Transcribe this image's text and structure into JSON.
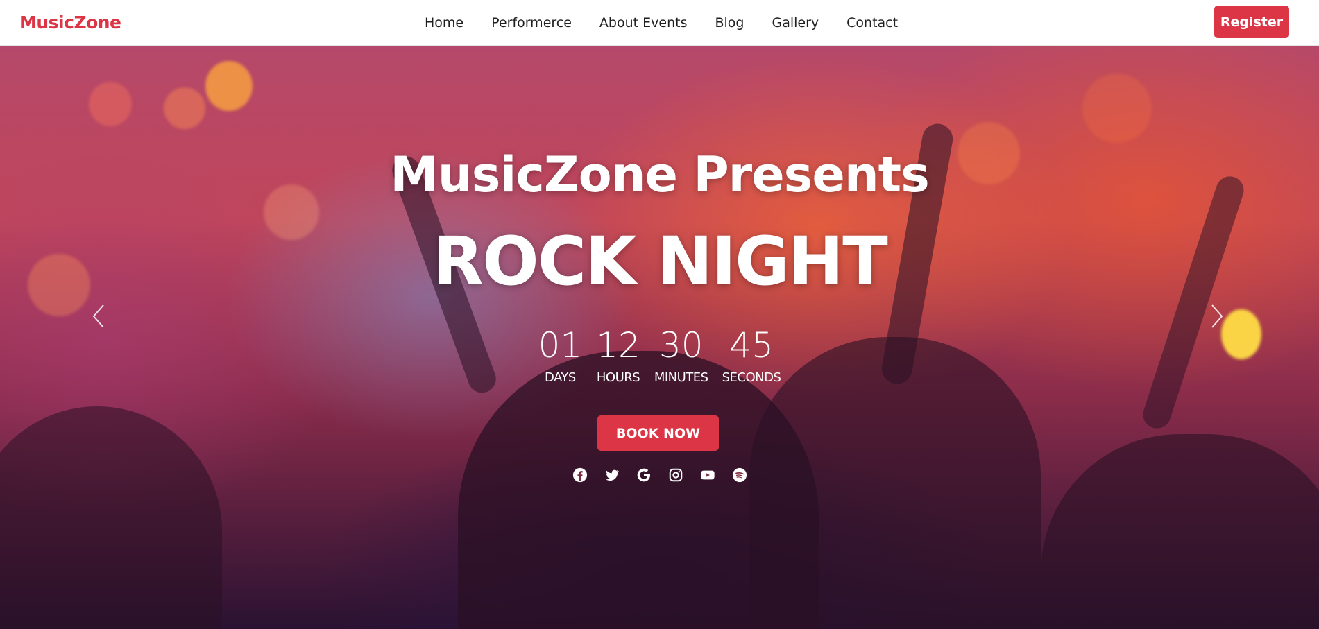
{
  "nav": {
    "brand": "MusicZone",
    "links": [
      "Home",
      "Performerce",
      "About Events",
      "Blog",
      "Gallery",
      "Contact"
    ],
    "register_label": "Register"
  },
  "hero": {
    "presents": "MusicZone Presents",
    "event_name": "ROCK NIGHT",
    "countdown": [
      {
        "value": "01",
        "label": "DAYS"
      },
      {
        "value": "12",
        "label": "HOURS"
      },
      {
        "value": "30",
        "label": "MINUTES"
      },
      {
        "value": "45",
        "label": "SECONDS"
      }
    ],
    "book_label": "BOOK NOW",
    "socials": [
      "facebook-icon",
      "twitter-icon",
      "google-icon",
      "instagram-icon",
      "youtube-icon",
      "spotify-icon"
    ]
  },
  "colors": {
    "accent": "#dc3545",
    "nav_bg": "#ffffff",
    "hero_text": "#ffffff"
  }
}
